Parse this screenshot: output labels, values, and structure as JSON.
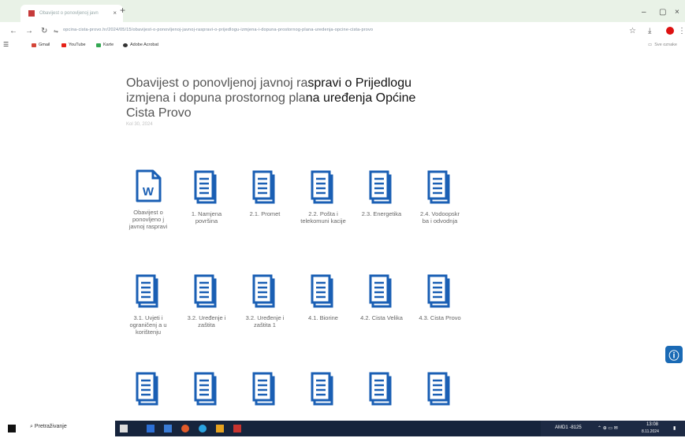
{
  "browser": {
    "tab_title": "Obavijest o ponovljenoj javn",
    "tab_close": "×",
    "new_tab": "+",
    "url": "opcina-cista-provo.hr/2024/05/15/obavijest-o-ponovljenoj-javnoj-raspravi-o-prijedlogu-izmjena-i-dopuna-prostornog-plana-uredenja-opcine-cista-provo",
    "bookmarks": [
      {
        "label": "Gmail",
        "color": "#d44638"
      },
      {
        "label": "YouTube",
        "color": "#e62117"
      },
      {
        "label": "Karte",
        "color": "#34a853"
      },
      {
        "label": "Adobe Acrobat",
        "color": "#333333"
      }
    ],
    "other_bookmarks": "Sve oznake"
  },
  "page": {
    "title_part1": "Obavijest o ponovljenoj javnoj ra",
    "title_bold1": "spravi o Prijedlogu",
    "title_part2": "izmjena i dopuna prostornog pla",
    "title_bold2": "na uređenja Općine",
    "title_part3": "Cista Provo",
    "date": "Kol 30, 2024"
  },
  "documents": [
    {
      "label": "Obavijest o ponovljeno j javnoj raspravi",
      "type": "word"
    },
    {
      "label": "1. Namjena površina",
      "type": "doc"
    },
    {
      "label": "2.1. Promet",
      "type": "doc"
    },
    {
      "label": "2.2. Pošta i telekomuni kacije",
      "type": "doc"
    },
    {
      "label": "2.3. Energetika",
      "type": "doc"
    },
    {
      "label": "2.4. Vodoopskr ba i odvodnja",
      "type": "doc"
    },
    {
      "label": "3.1. Uvjeti i ograničenj a u korištenju",
      "type": "doc"
    },
    {
      "label": "3.2. Uređenje i zaštita",
      "type": "doc"
    },
    {
      "label": "3.2. Uređenje i zaštita 1",
      "type": "doc"
    },
    {
      "label": "4.1. Biorine",
      "type": "doc"
    },
    {
      "label": "4.2. Cista Velika",
      "type": "doc"
    },
    {
      "label": "4.3. Cista Provo",
      "type": "doc"
    },
    {
      "label": "",
      "type": "doc"
    },
    {
      "label": "",
      "type": "doc"
    },
    {
      "label": "",
      "type": "doc"
    },
    {
      "label": "",
      "type": "doc"
    },
    {
      "label": "",
      "type": "doc"
    },
    {
      "label": "",
      "type": "doc"
    }
  ],
  "taskbar": {
    "search_placeholder": "Pretraživanje",
    "tray_text": "AMD1 -8125",
    "time": "13:08",
    "date": "8.11.2024"
  },
  "colors": {
    "accent": "#1a5fb4"
  }
}
